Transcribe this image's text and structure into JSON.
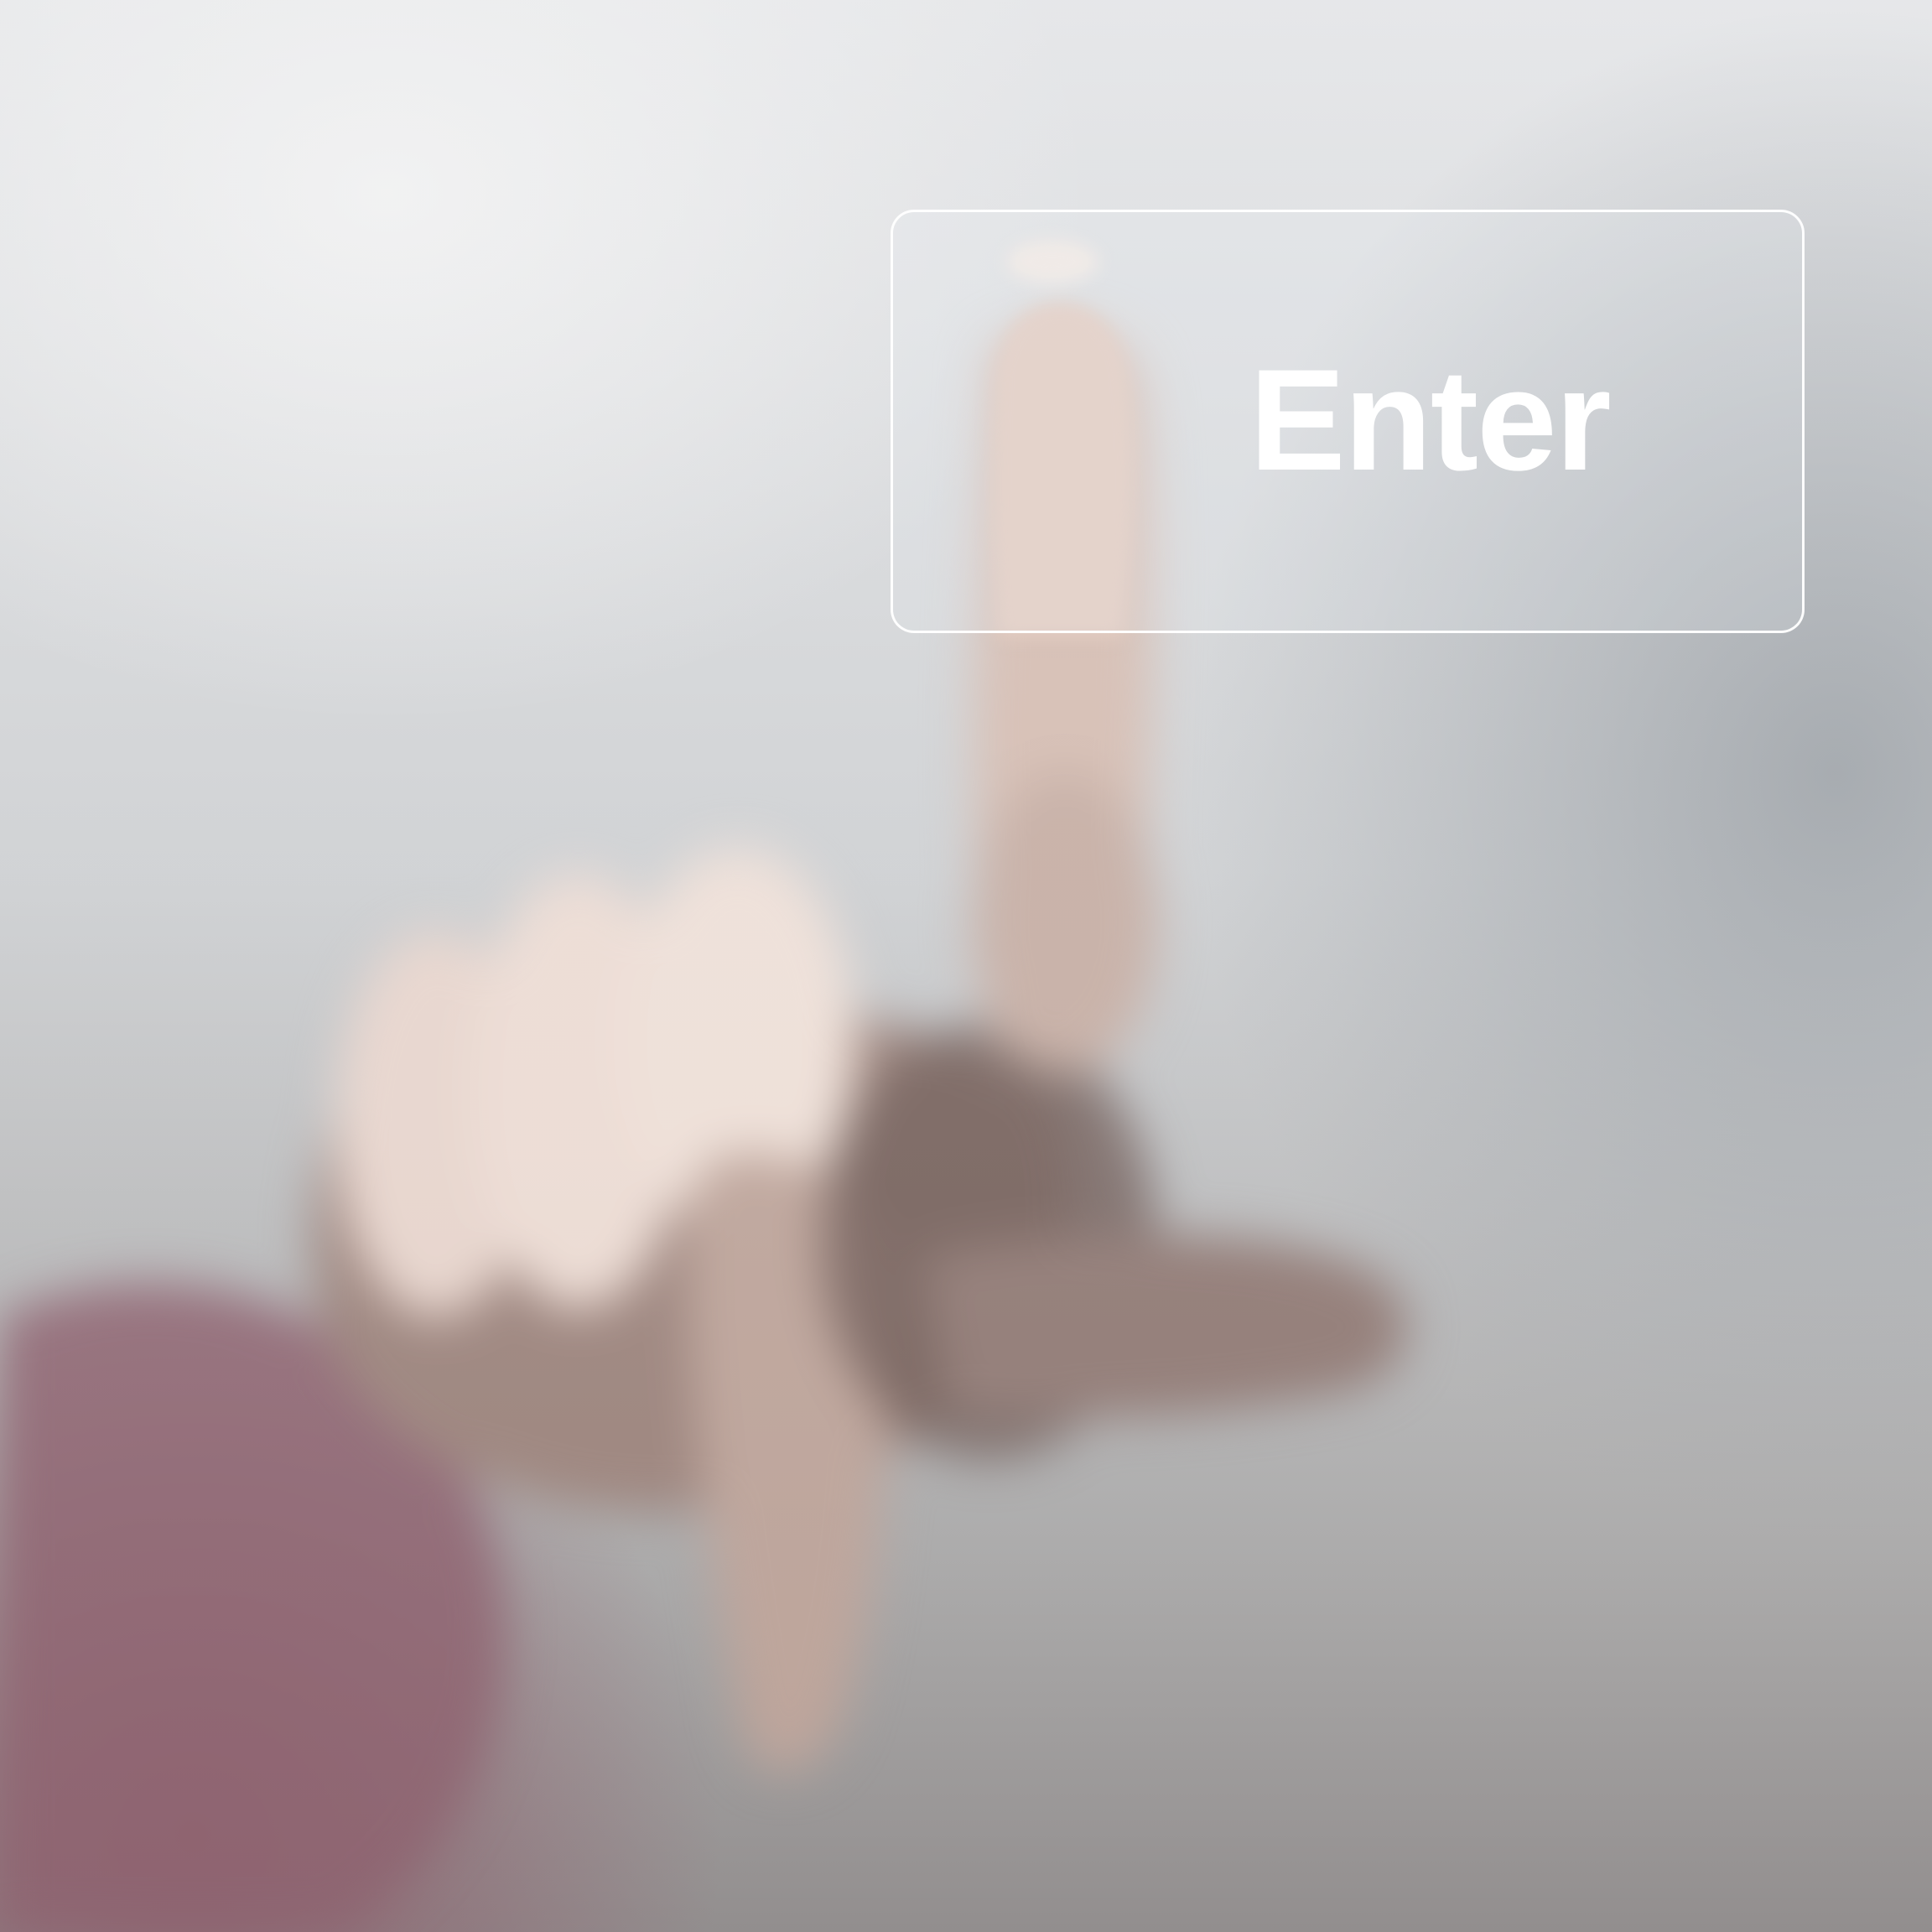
{
  "button": {
    "label": "Enter"
  },
  "colors": {
    "button_border": "#ffffff",
    "label": "#ffffff",
    "skin": "#e9cbbd",
    "skin_shadow": "#6a5550",
    "sleeve": "#8a5a68",
    "background_light": "#f4f4f4",
    "background_dark": "#8e8a8a"
  },
  "icons": {
    "hand": "pointing-hand-icon"
  }
}
